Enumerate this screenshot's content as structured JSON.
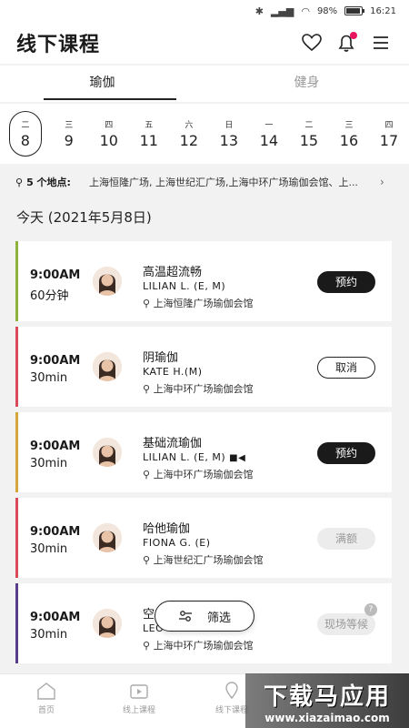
{
  "status_bar": {
    "battery": "98%",
    "time": "16:21"
  },
  "header": {
    "title": "线下课程"
  },
  "tabs": [
    {
      "label": "瑜伽",
      "active": true
    },
    {
      "label": "健身",
      "active": false
    }
  ],
  "dates": [
    {
      "weekday": "二",
      "day": "8",
      "selected": true
    },
    {
      "weekday": "三",
      "day": "9"
    },
    {
      "weekday": "四",
      "day": "10"
    },
    {
      "weekday": "五",
      "day": "11"
    },
    {
      "weekday": "六",
      "day": "12"
    },
    {
      "weekday": "日",
      "day": "13"
    },
    {
      "weekday": "一",
      "day": "14"
    },
    {
      "weekday": "二",
      "day": "15"
    },
    {
      "weekday": "三",
      "day": "16"
    },
    {
      "weekday": "四",
      "day": "17"
    }
  ],
  "locations": {
    "count_label": "5 个地点:",
    "list": "上海恒隆广场, 上海世纪汇广场,上海中环广场瑜伽会馆、上..."
  },
  "today_label": "今天 (2021年5月8日)",
  "classes": [
    {
      "time": "9:00AM",
      "duration": "60分钟",
      "name": "高温超流畅",
      "teacher": "LILIAN L. (E, M)",
      "venue": "上海恒隆广场瑜伽会馆",
      "button": "预约",
      "button_style": "dark",
      "accent": "#8db33c",
      "video": false
    },
    {
      "time": "9:00AM",
      "duration": "30min",
      "name": "阴瑜伽",
      "teacher": "KATE H.(M)",
      "venue": "上海中环广场瑜伽会馆",
      "button": "取消",
      "button_style": "outline",
      "accent": "#d94b5a",
      "video": false
    },
    {
      "time": "9:00AM",
      "duration": "30min",
      "name": "基础流瑜伽",
      "teacher": "LILIAN L. (E, M)",
      "venue": "上海中环广场瑜伽会馆",
      "button": "预约",
      "button_style": "dark",
      "accent": "#d6a53c",
      "video": true
    },
    {
      "time": "9:00AM",
      "duration": "30min",
      "name": "哈他瑜伽",
      "teacher": "FIONA G. (E)",
      "venue": "上海世纪汇广场瑜伽会馆",
      "button": "满额",
      "button_style": "gray",
      "accent": "#d94b5a",
      "video": false
    },
    {
      "time": "9:00AM",
      "duration": "30min",
      "name": "空",
      "teacher": "LEO",
      "venue": "上海中环广场瑜伽会馆",
      "button": "现场等候",
      "button_style": "gray",
      "accent": "#5a3d8a",
      "video": false
    }
  ],
  "filter": {
    "label": "筛选"
  },
  "bottom_nav": [
    {
      "label": "首页"
    },
    {
      "label": "线上课程"
    },
    {
      "label": "线下课程"
    }
  ],
  "watermark": {
    "title": "下载马应用",
    "url": "www.xiazaimao.com"
  }
}
